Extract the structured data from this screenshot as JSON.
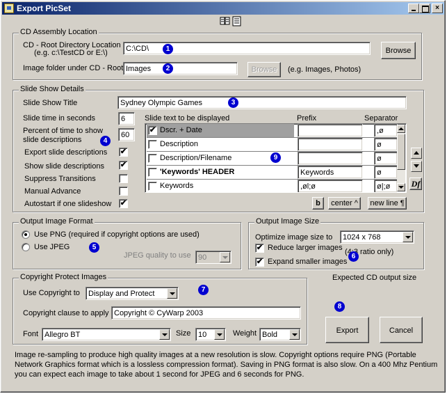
{
  "window": {
    "title": "Export PicSet"
  },
  "cd_location": {
    "legend": "CD Assembly Location",
    "root_label_line1": "CD - Root Directory Location",
    "root_label_line2": "(e.g. c:\\TestCD or E:\\)",
    "root_value": "C:\\CD\\",
    "browse_label": "Browse",
    "image_folder_label": "Image folder under CD - Root",
    "image_folder_value": "Images",
    "browse2_label": "Browse",
    "image_folder_hint": "(e.g. Images, Photos)"
  },
  "slideshow": {
    "legend": "Slide Show Details",
    "title_label": "Slide Show Title",
    "title_value": "Sydney Olympic Games",
    "time_label": "Slide time in seconds",
    "time_value": "6",
    "percent_label_line1": "Percent of time to show",
    "percent_label_line2": "slide descriptions",
    "percent_value": "60",
    "options": [
      {
        "label": "Export slide descriptions",
        "checked": "✔"
      },
      {
        "label": "Show slide descriptions",
        "checked": "✔"
      },
      {
        "label": "Suppress Transitions",
        "checked": ""
      },
      {
        "label": "Manual Advance",
        "checked": ""
      },
      {
        "label": "Autostart if one slideshow",
        "checked": "✔"
      }
    ],
    "list_header": "Slide text to be displayed",
    "prefix_header": "Prefix",
    "separator_header": "Separator",
    "rows": [
      {
        "label": "Dscr. + Date",
        "checked": "✔",
        "prefix": "",
        "separator": ",ø",
        "bold": false
      },
      {
        "label": "Description",
        "checked": "",
        "prefix": "",
        "separator": "ø",
        "bold": false
      },
      {
        "label": "Description/Filename",
        "checked": "",
        "prefix": "",
        "separator": "ø",
        "bold": false
      },
      {
        "label": "'Keywords' HEADER",
        "checked": "",
        "prefix": "Keywords",
        "separator": "ø",
        "bold": true
      },
      {
        "label": "Keywords",
        "checked": "",
        "prefix": ",øl;ø",
        "separator": "ø|;ø",
        "bold": false
      }
    ],
    "bold_button": "b",
    "center_button": "center ^",
    "newline_button": "new line ¶",
    "df_button": "Df"
  },
  "output_format": {
    "legend": "Output Image Format",
    "png_label": "Use PNG (required if copyright options are used)",
    "jpeg_label": "Use JPEG",
    "jpeg_quality_label": "JPEG quality to use",
    "jpeg_quality_value": "90"
  },
  "output_size": {
    "legend": "Output Image Size",
    "optimize_label": "Optimize image size to",
    "optimize_value": "1024 x 768",
    "reduce_label": "Reduce larger images",
    "reduce_checked": "✔",
    "expand_label": "Expand smaller images",
    "expand_checked": "✔",
    "ratio_note": "(4:3 ratio only)"
  },
  "copyright": {
    "legend": "Copyright Protect Images",
    "use_label": "Use Copyright to",
    "use_value": "Display and Protect",
    "clause_label": "Copyright clause to apply",
    "clause_value": "Copyright © CyWarp 2003",
    "font_label": "Font",
    "font_value": "Allegro BT",
    "size_label": "Size",
    "size_value": "10",
    "weight_label": "Weight",
    "weight_value": "Bold"
  },
  "actions": {
    "expected_label": "Expected CD output size",
    "export_label": "Export",
    "cancel_label": "Cancel"
  },
  "footer": {
    "text": "Image re-sampling to produce high quality images at a new resolution is slow. Copyright options require PNG (Portable Network Graphics format which is a lossless compression format). Saving in PNG format is also slow. On a 400 Mhz Pentium you can expect each image to take about 1 second for JPEG and 6 seconds for PNG."
  },
  "markers": [
    "1",
    "2",
    "3",
    "4",
    "5",
    "6",
    "7",
    "8",
    "9"
  ],
  "colors": {
    "titlebar_start": "#0a246a",
    "titlebar_end": "#a6caf0",
    "face": "#d4d0c8",
    "marker": "#0000d0"
  }
}
